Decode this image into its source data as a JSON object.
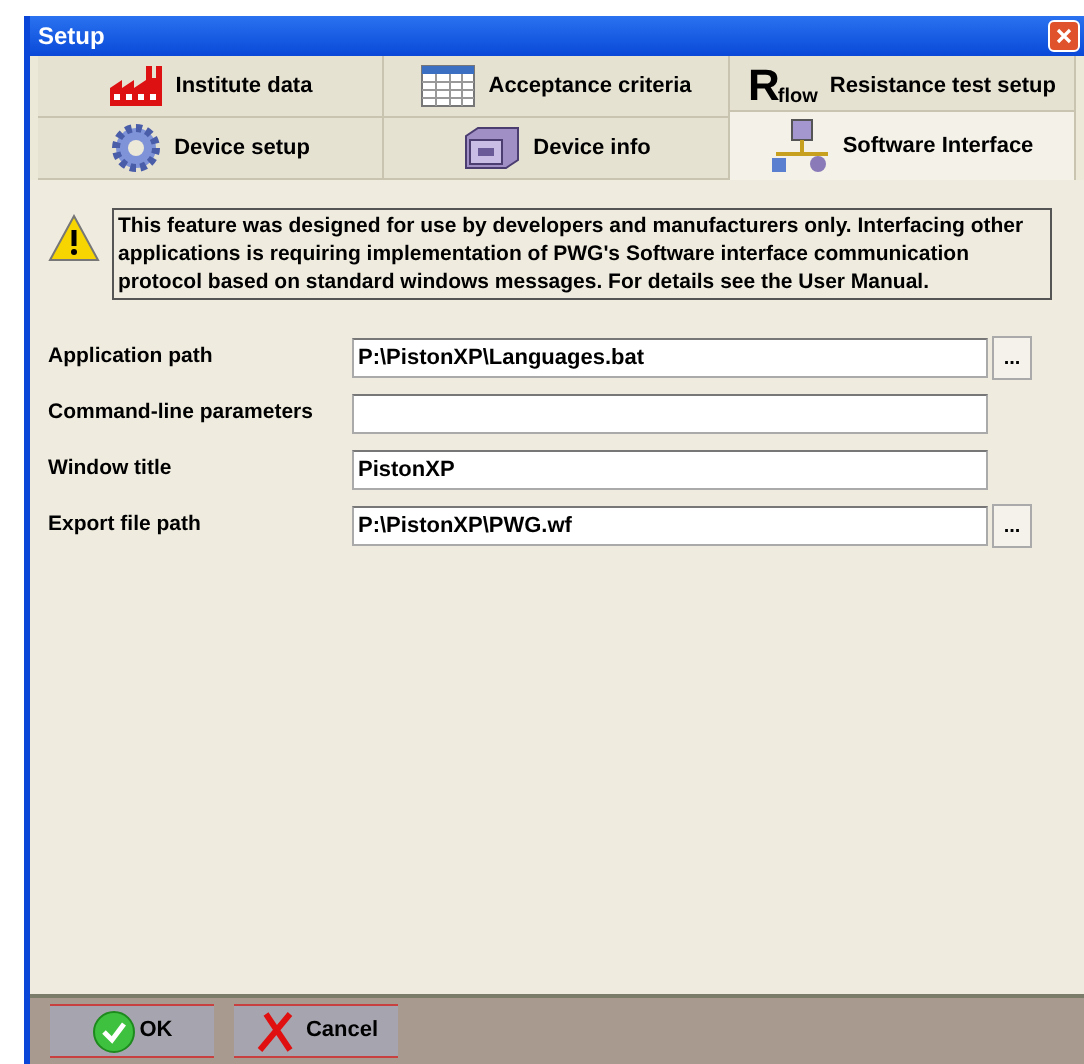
{
  "window": {
    "title": "Setup"
  },
  "tab_rows": [
    [
      {
        "label": "Institute data",
        "kind": "factory",
        "selected": false
      },
      {
        "label": "Acceptance criteria",
        "kind": "table",
        "selected": false
      },
      {
        "label": "Resistance test setup",
        "kind": "rflow",
        "selected": false,
        "icon_text": "R",
        "icon_sub": "flow"
      }
    ],
    [
      {
        "label": "Device setup",
        "kind": "gear",
        "selected": false
      },
      {
        "label": "Device info",
        "kind": "device",
        "selected": false
      },
      {
        "label": "Software Interface",
        "kind": "network",
        "selected": true
      }
    ]
  ],
  "notice": "This feature was designed for use by developers and manufacturers only. Interfacing other applications is requiring implementation of PWG's Software interface communication protocol based on standard windows messages. For details see the User Manual.",
  "fields": [
    {
      "label": "Application path",
      "value": "P:\\PistonXP\\Languages.bat",
      "browse": "..."
    },
    {
      "label": "Command-line parameters"
    },
    {
      "label": "Window title",
      "value": "PistonXP"
    },
    {
      "label": "Export file path",
      "value": "P:\\PistonXP\\PWG.wf",
      "browse": "..."
    }
  ],
  "buttons": [
    {
      "label": "OK",
      "kind": "ok"
    },
    {
      "label": "Cancel",
      "kind": "cancel"
    }
  ]
}
